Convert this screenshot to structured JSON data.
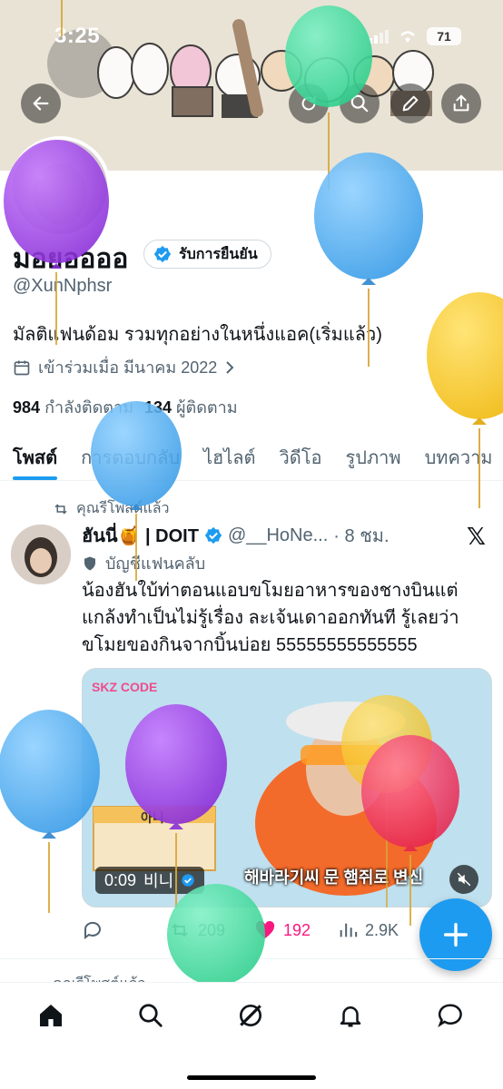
{
  "status_bar": {
    "time": "3:25",
    "battery": "71"
  },
  "profile": {
    "display_name": "มอยออออ",
    "verified_label": "รับการยืนยัน",
    "handle": "@XunNphsr",
    "bio": "มัลติแฟนด้อม รวมทุกอย่างในหนึ่งแอค(เริ่มแล้ว)",
    "joined": "เข้าร่วมเมื่อ มีนาคม 2022",
    "following_count": "984",
    "following_label": "กำลังติดตาม",
    "followers_count": "134",
    "followers_label": "ผู้ติดตาม"
  },
  "tabs": [
    {
      "label": "โพสต์",
      "active": true
    },
    {
      "label": "การตอบกลับ",
      "active": false
    },
    {
      "label": "ไฮไลต์",
      "active": false
    },
    {
      "label": "วิดีโอ",
      "active": false
    },
    {
      "label": "รูปภาพ",
      "active": false
    },
    {
      "label": "บทความ",
      "active": false
    }
  ],
  "post": {
    "repost_label": "คุณรีโพสต์แล้ว",
    "author_name": "ฮันนี่🍯 | DOIT",
    "author_handle": "@__HoNe...",
    "time": "· 8 ชม.",
    "fanclub_label": "บัญชีแฟนคลับ",
    "text": "น้องฮันใบ้ท่าตอนแอบขโมยอาหารของชางบินแต่แกล้งทำเป็นไม่รู้เรื่อง ละเจ้นเดาออกทันที รู้เลยว่าขโมยของกินจากบิ้นบ่อย 55555555555555",
    "media": {
      "duration": "0:09",
      "uploader": "비니",
      "subtitle": "해바라기씨 문 햄쥐로 변신",
      "logo_text": "SKZ CODE",
      "card_text": "아니"
    },
    "stats": {
      "reposts": "209",
      "likes": "192",
      "views": "2.9K"
    }
  },
  "next_post": {
    "repost_label": "คุณรีโพสต์แล้ว"
  },
  "icons": {
    "back": "arrow-left-icon",
    "refresh": "refresh-icon",
    "search": "search-icon",
    "edit": "pencil-icon",
    "share": "share-icon",
    "verified": "verified-badge-icon",
    "calendar": "calendar-icon",
    "repost": "repost-icon",
    "reply": "reply-icon",
    "like": "heart-icon",
    "views": "views-icon",
    "mute": "mute-icon",
    "home": "home-icon",
    "explore": "search-icon",
    "grok": "grok-icon",
    "notifications": "bell-icon",
    "messages": "message-icon"
  },
  "colors": {
    "accent": "#1d9bf0",
    "like": "#f91880",
    "text": "#0f1419",
    "secondary": "#536471"
  }
}
